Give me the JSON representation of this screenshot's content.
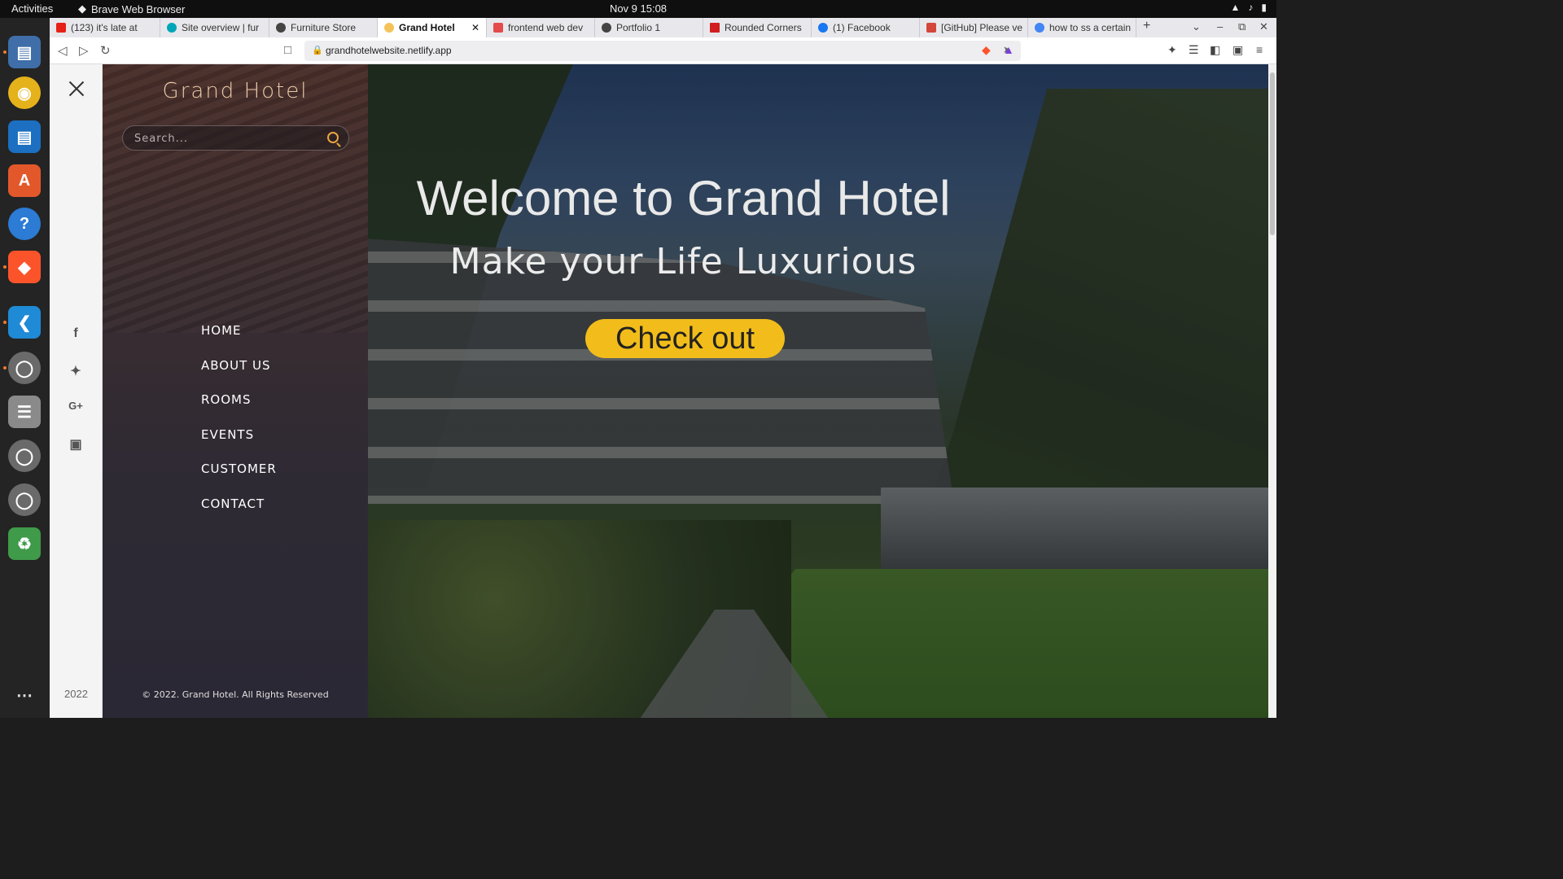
{
  "os": {
    "activities": "Activities",
    "app_name": "Brave Web Browser",
    "clock": "Nov 9  15:08"
  },
  "browser": {
    "tabs": [
      {
        "label": "(123) it's late at",
        "color": "#e62117"
      },
      {
        "label": "Site overview | fur",
        "color": "#00a6b8"
      },
      {
        "label": "Furniture Store",
        "color": "#444444"
      },
      {
        "label": "Grand Hotel",
        "color": "#f3c35a",
        "active": true
      },
      {
        "label": "frontend web dev",
        "color": "#e44b4b"
      },
      {
        "label": "Portfolio 1",
        "color": "#444444"
      },
      {
        "label": "Rounded Corners",
        "color": "#d11f1f"
      },
      {
        "label": "(1) Facebook",
        "color": "#1877f2"
      },
      {
        "label": "[GitHub] Please ve",
        "color": "#d4463b"
      },
      {
        "label": "how to ss a certain",
        "color": "#4285f4"
      }
    ],
    "new_tab": "+",
    "url": "grandhotelwebsite.netlify.app"
  },
  "site": {
    "brand": "Grand Hotel",
    "search_placeholder": "Search...",
    "menu": [
      "HOME",
      "ABOUT US",
      "ROOMS",
      "EVENTS",
      "CUSTOMER",
      "CONTACT"
    ],
    "social": [
      "facebook-icon",
      "twitter-icon",
      "google-plus-icon",
      "instagram-icon"
    ],
    "year": "2022",
    "copyright": "© 2022. Grand Hotel. All Rights Reserved",
    "hero_title": "Welcome to Grand Hotel",
    "hero_subtitle": "Make your Life Luxurious",
    "cta_label": "Check out",
    "cta_color": "#f2bd1a",
    "accent": "#e8a640"
  }
}
